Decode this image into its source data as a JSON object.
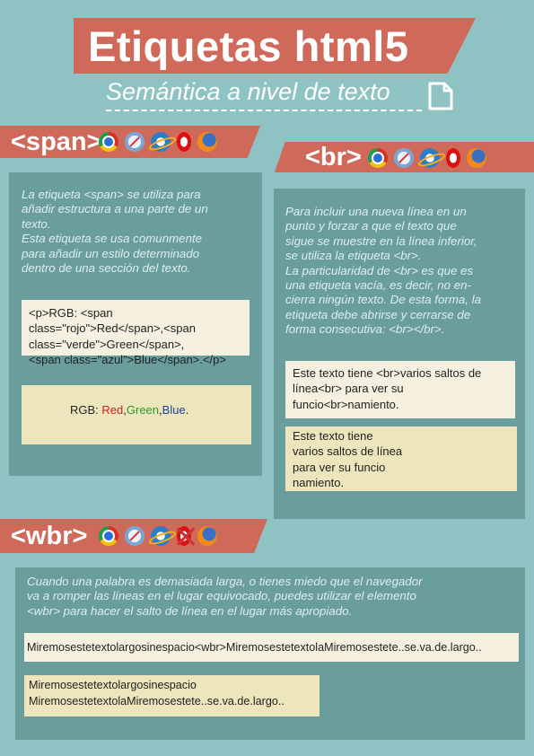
{
  "header": {
    "title": "Etiquetas html5",
    "subtitle": "Semántica a nivel de texto",
    "icon": "document-icon"
  },
  "colors": {
    "background": "#8fc3c3",
    "ribbon": "#cf6a5a",
    "panel": "#6a9e9d",
    "code_box": "#f6f0e0",
    "result_box": "#ede5bb",
    "red": "#d02020",
    "green": "#2a9a2a",
    "blue": "#1f3fa0"
  },
  "span_section": {
    "tag": "<span>",
    "browsers": [
      "chrome-icon",
      "safari-icon",
      "ie-icon",
      "opera-icon",
      "firefox-icon"
    ],
    "description": "La etiqueta <span> se utiliza para\nañadir estructura a una parte de un\ntexto.\nEsta etiqueta se usa comunmente\npara añadir un estilo determinado\ndentro de una sección del texto.",
    "code": "<p>RGB: <span\nclass=\"rojo\">Red</span>,<span\nclass=\"verde\">Green</span>,\n<span class=\"azul\">Blue</span>.</p>",
    "result": {
      "prefix": "RGB: ",
      "red": "Red",
      "sep1": ",",
      "green": "Green",
      "sep2": ",",
      "blue": "Blue",
      "suffix": "."
    }
  },
  "br_section": {
    "tag": "<br>",
    "browsers": [
      "chrome-icon",
      "safari-icon",
      "ie-icon",
      "opera-icon",
      "firefox-icon"
    ],
    "description": "Para incluir una nueva línea en un\npunto y forzar a que el texto que\nsigue se muestre en la línea inferior,\nse utiliza la etiqueta <br>.\nLa particularidad de <br> es que es\nuna etiqueta vacía, es decir, no en-\ncierra ningún texto. De esta forma, la\netiqueta debe abrirse y cerrarse de\nforma consecutiva: <br></br>.",
    "code": "Este texto tiene <br>varios saltos de\nlínea<br> para ver su\nfuncio<br>namiento.",
    "result": "Este texto tiene\nvarios saltos de línea\npara ver su funcio\nnamiento."
  },
  "wbr_section": {
    "tag": "<wbr>",
    "browsers": [
      "chrome-icon",
      "safari-icon",
      "ie-icon",
      "opera-unsupported-icon",
      "firefox-icon"
    ],
    "description": "Cuando una palabra es demasiada larga, o tienes miedo que el navegador\nva a romper las líneas en el lugar equivocado, puedes utilizar el elemento\n<wbr> para hacer el salto de línea en el lugar más apropiado.",
    "code": "Miremosestetextolargosinespacio<wbr>MiremosestetextolaMiremosestete..se.va.de.largo..",
    "result": "Miremosestetextolargosinespacio\nMiremosestetextolaMiremosestete..se.va.de.largo.."
  }
}
